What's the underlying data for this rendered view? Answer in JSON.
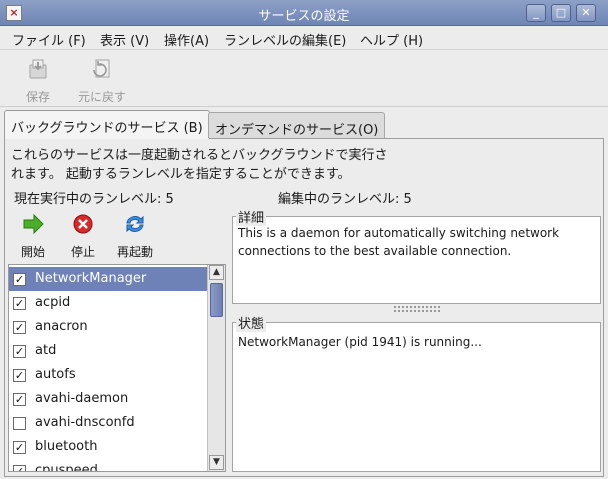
{
  "window": {
    "title": "サービスの設定",
    "minimize": "_",
    "maximize": "□",
    "close": "✕"
  },
  "menu": [
    "ファイル (F)",
    "表示 (V)",
    "操作(A)",
    "ランレベルの編集(E)",
    "ヘルプ (H)"
  ],
  "toolbar": {
    "save": "保存",
    "revert": "元に戻す"
  },
  "tabs": {
    "background": "バックグラウンドのサービス (B)",
    "ondemand": "オンデマンドのサービス(O)"
  },
  "description": {
    "line1": "これらのサービスは一度起動されるとバックグラウンドで実行さ",
    "line2": "れます。 起動するランレベルを指定することができます。"
  },
  "runlevel": {
    "current": "現在実行中のランレベル: 5",
    "editing": "編集中のランレベル: 5"
  },
  "actions": {
    "start": "開始",
    "stop": "停止",
    "restart": "再起動"
  },
  "services": [
    {
      "name": "NetworkManager",
      "checked": true,
      "selected": true
    },
    {
      "name": "acpid",
      "checked": true
    },
    {
      "name": "anacron",
      "checked": true
    },
    {
      "name": "atd",
      "checked": true
    },
    {
      "name": "autofs",
      "checked": true
    },
    {
      "name": "avahi-daemon",
      "checked": true
    },
    {
      "name": "avahi-dnsconfd",
      "checked": false
    },
    {
      "name": "bluetooth",
      "checked": true
    },
    {
      "name": "cpuspeed",
      "checked": true
    }
  ],
  "details": {
    "label": "詳細",
    "line1": "This is a daemon for automatically switching network",
    "line2": "connections to the best available connection."
  },
  "status": {
    "label": "状態",
    "text": "NetworkManager (pid 1941) is running..."
  }
}
